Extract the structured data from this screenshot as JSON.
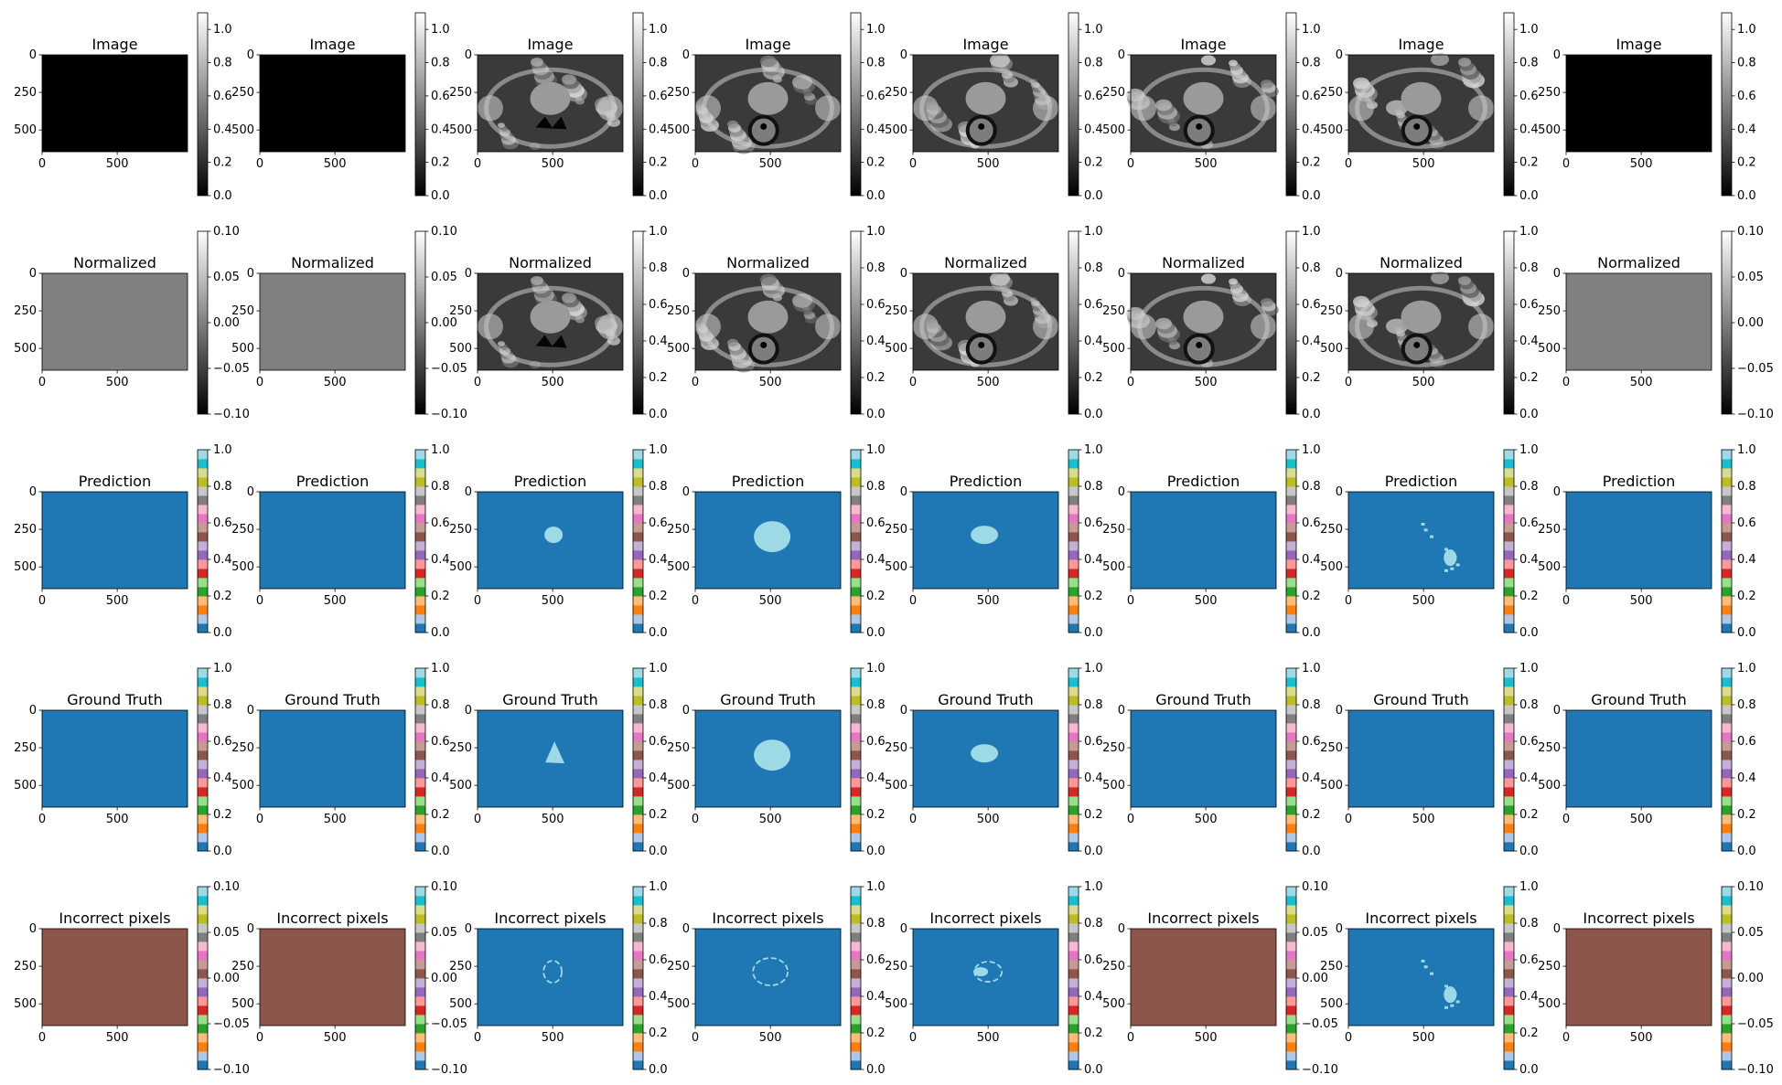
{
  "figure": {
    "columns": 8,
    "rows": [
      "Image",
      "Normalized",
      "Prediction",
      "Ground Truth",
      "Incorrect pixels"
    ]
  },
  "axes_common": {
    "xticks": [
      "0",
      "500"
    ],
    "yticks": [
      "0",
      "250",
      "500"
    ],
    "xlim": [
      0,
      968
    ],
    "ylim": [
      645,
      0
    ]
  },
  "colorbars": {
    "gray_0_1": {
      "cmap": "gray",
      "ticks": [
        "0.0",
        "0.2",
        "0.4",
        "0.6",
        "0.8",
        "1.0"
      ],
      "range": [
        0,
        1.1
      ]
    },
    "gray_0_1_exact": {
      "cmap": "gray",
      "ticks": [
        "0.0",
        "0.2",
        "0.4",
        "0.6",
        "0.8",
        "1.0"
      ],
      "range": [
        0,
        1.0
      ]
    },
    "gray_pm01": {
      "cmap": "gray",
      "ticks": [
        "−0.10",
        "−0.05",
        "0.00",
        "0.05",
        "0.10"
      ],
      "range": [
        -0.1,
        0.1
      ]
    },
    "tab20_0_1": {
      "cmap": "tab20",
      "ticks": [
        "0.0",
        "0.2",
        "0.4",
        "0.6",
        "0.8",
        "1.0"
      ],
      "range": [
        0,
        1.0
      ]
    },
    "tab20_pm01": {
      "cmap": "tab20",
      "ticks": [
        "−0.10",
        "−0.05",
        "0.00",
        "0.05",
        "0.10"
      ],
      "range": [
        -0.1,
        0.1
      ]
    }
  },
  "colors": {
    "tab20": [
      "#1f77b4",
      "#aec7e8",
      "#ff7f0e",
      "#ffbb78",
      "#2ca02c",
      "#98df8a",
      "#d62728",
      "#ff9896",
      "#9467bd",
      "#c5b0d5",
      "#8c564b",
      "#c49c94",
      "#e377c2",
      "#f7b6d2",
      "#7f7f7f",
      "#c7c7c7",
      "#bcbd22",
      "#dbdb8d",
      "#17becf",
      "#9edae5"
    ],
    "background_class": "#1f77b4",
    "foreground_class": "#9edae5",
    "constant_zero_tab20": "#8c564b",
    "constant_zero_gray": "#808080",
    "black": "#000000"
  },
  "chart_data": {
    "type": "heatmap",
    "panels": [
      [
        {
          "title": "Image",
          "content": "blank",
          "cbar": "gray_0_1"
        },
        {
          "title": "Image",
          "content": "blank",
          "cbar": "gray_0_1"
        },
        {
          "title": "Image",
          "content": "mri",
          "cbar": "gray_0_1"
        },
        {
          "title": "Image",
          "content": "mri",
          "cbar": "gray_0_1"
        },
        {
          "title": "Image",
          "content": "mri",
          "cbar": "gray_0_1"
        },
        {
          "title": "Image",
          "content": "mri",
          "cbar": "gray_0_1"
        },
        {
          "title": "Image",
          "content": "mri",
          "cbar": "gray_0_1"
        },
        {
          "title": "Image",
          "content": "blank",
          "cbar": "gray_0_1"
        }
      ],
      [
        {
          "title": "Normalized",
          "content": "gray",
          "cbar": "gray_pm01"
        },
        {
          "title": "Normalized",
          "content": "gray",
          "cbar": "gray_pm01"
        },
        {
          "title": "Normalized",
          "content": "mri",
          "cbar": "gray_0_1_exact"
        },
        {
          "title": "Normalized",
          "content": "mri",
          "cbar": "gray_0_1_exact"
        },
        {
          "title": "Normalized",
          "content": "mri",
          "cbar": "gray_0_1_exact"
        },
        {
          "title": "Normalized",
          "content": "mri",
          "cbar": "gray_0_1_exact"
        },
        {
          "title": "Normalized",
          "content": "mri",
          "cbar": "gray_0_1_exact"
        },
        {
          "title": "Normalized",
          "content": "gray",
          "cbar": "gray_pm01"
        }
      ],
      [
        {
          "title": "Prediction",
          "content": "empty",
          "cbar": "tab20_0_1"
        },
        {
          "title": "Prediction",
          "content": "empty",
          "cbar": "tab20_0_1"
        },
        {
          "title": "Prediction",
          "content": "blob-small",
          "cbar": "tab20_0_1"
        },
        {
          "title": "Prediction",
          "content": "blob-large",
          "cbar": "tab20_0_1"
        },
        {
          "title": "Prediction",
          "content": "blob-medium",
          "cbar": "tab20_0_1"
        },
        {
          "title": "Prediction",
          "content": "empty",
          "cbar": "tab20_0_1"
        },
        {
          "title": "Prediction",
          "content": "scatter",
          "cbar": "tab20_0_1"
        },
        {
          "title": "Prediction",
          "content": "empty",
          "cbar": "tab20_0_1"
        }
      ],
      [
        {
          "title": "Ground Truth",
          "content": "empty",
          "cbar": "tab20_0_1"
        },
        {
          "title": "Ground Truth",
          "content": "empty",
          "cbar": "tab20_0_1"
        },
        {
          "title": "Ground Truth",
          "content": "triangle",
          "cbar": "tab20_0_1"
        },
        {
          "title": "Ground Truth",
          "content": "blob-large",
          "cbar": "tab20_0_1"
        },
        {
          "title": "Ground Truth",
          "content": "blob-medium",
          "cbar": "tab20_0_1"
        },
        {
          "title": "Ground Truth",
          "content": "empty",
          "cbar": "tab20_0_1"
        },
        {
          "title": "Ground Truth",
          "content": "empty",
          "cbar": "tab20_0_1"
        },
        {
          "title": "Ground Truth",
          "content": "empty",
          "cbar": "tab20_0_1"
        }
      ],
      [
        {
          "title": "Incorrect pixels",
          "content": "brown",
          "cbar": "tab20_pm01"
        },
        {
          "title": "Incorrect pixels",
          "content": "brown",
          "cbar": "tab20_pm01"
        },
        {
          "title": "Incorrect pixels",
          "content": "outline-small",
          "cbar": "tab20_0_1"
        },
        {
          "title": "Incorrect pixels",
          "content": "outline-large",
          "cbar": "tab20_0_1"
        },
        {
          "title": "Incorrect pixels",
          "content": "outline-medium",
          "cbar": "tab20_0_1"
        },
        {
          "title": "Incorrect pixels",
          "content": "brown",
          "cbar": "tab20_pm01"
        },
        {
          "title": "Incorrect pixels",
          "content": "scatter",
          "cbar": "tab20_0_1"
        },
        {
          "title": "Incorrect pixels",
          "content": "brown",
          "cbar": "tab20_pm01"
        }
      ]
    ]
  }
}
